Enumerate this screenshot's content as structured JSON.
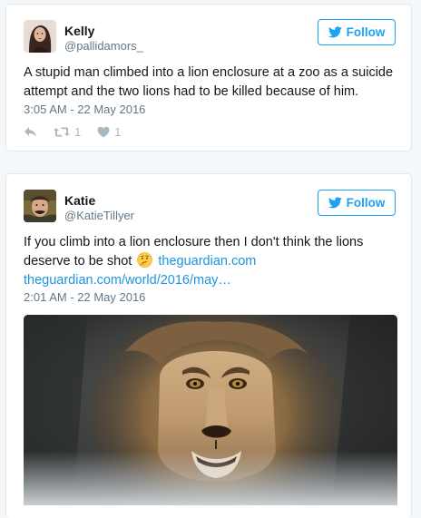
{
  "tweets": [
    {
      "name": "Kelly",
      "handle": "@pallidamors_",
      "follow_label": "Follow",
      "text": "A stupid man climbed into a lion enclosure at a zoo as a suicide attempt and the two lions had to be killed because of him.",
      "timestamp": "3:05 AM - 22 May 2016",
      "retweets": "1",
      "likes": "1"
    },
    {
      "name": "Katie",
      "handle": "@KatieTillyer",
      "follow_label": "Follow",
      "text_before_emoji": "If you climb into a lion enclosure then I don't think the lions deserve to be shot",
      "link_domain": "theguardian.com",
      "link_url": "theguardian.com/world/2016/may…",
      "timestamp": "2:01 AM - 22 May 2016"
    }
  ],
  "colors": {
    "accent": "#1da1f2",
    "link": "#1b95e0",
    "muted": "#657786",
    "icon": "#aab8c2"
  },
  "icons": {
    "follow": "twitter-bird-icon",
    "reply": "reply-icon",
    "retweet": "retweet-icon",
    "like": "heart-icon",
    "emoji": "thinking-face-emoji"
  }
}
